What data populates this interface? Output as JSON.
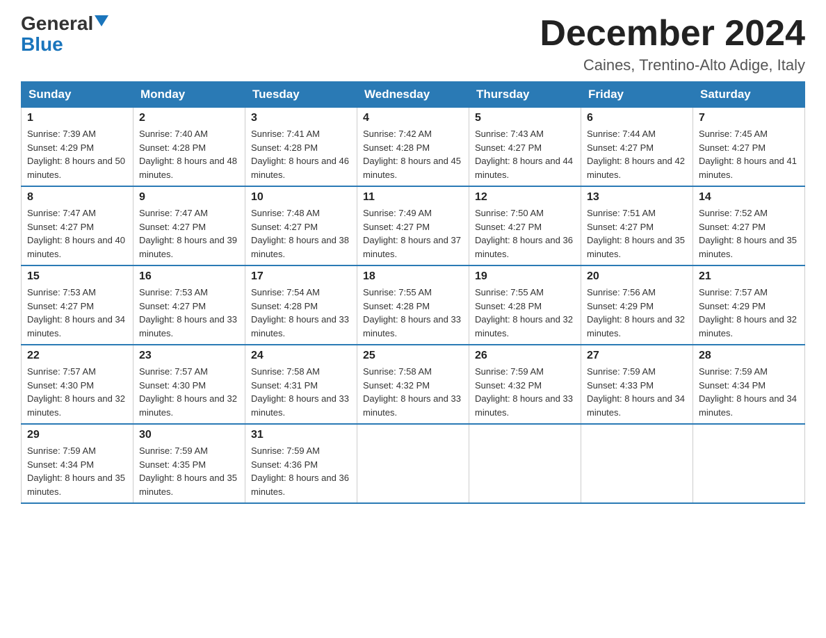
{
  "logo": {
    "general": "General",
    "blue": "Blue"
  },
  "title": "December 2024",
  "location": "Caines, Trentino-Alto Adige, Italy",
  "days_of_week": [
    "Sunday",
    "Monday",
    "Tuesday",
    "Wednesday",
    "Thursday",
    "Friday",
    "Saturday"
  ],
  "weeks": [
    [
      {
        "day": "1",
        "sunrise": "7:39 AM",
        "sunset": "4:29 PM",
        "daylight": "8 hours and 50 minutes."
      },
      {
        "day": "2",
        "sunrise": "7:40 AM",
        "sunset": "4:28 PM",
        "daylight": "8 hours and 48 minutes."
      },
      {
        "day": "3",
        "sunrise": "7:41 AM",
        "sunset": "4:28 PM",
        "daylight": "8 hours and 46 minutes."
      },
      {
        "day": "4",
        "sunrise": "7:42 AM",
        "sunset": "4:28 PM",
        "daylight": "8 hours and 45 minutes."
      },
      {
        "day": "5",
        "sunrise": "7:43 AM",
        "sunset": "4:27 PM",
        "daylight": "8 hours and 44 minutes."
      },
      {
        "day": "6",
        "sunrise": "7:44 AM",
        "sunset": "4:27 PM",
        "daylight": "8 hours and 42 minutes."
      },
      {
        "day": "7",
        "sunrise": "7:45 AM",
        "sunset": "4:27 PM",
        "daylight": "8 hours and 41 minutes."
      }
    ],
    [
      {
        "day": "8",
        "sunrise": "7:47 AM",
        "sunset": "4:27 PM",
        "daylight": "8 hours and 40 minutes."
      },
      {
        "day": "9",
        "sunrise": "7:47 AM",
        "sunset": "4:27 PM",
        "daylight": "8 hours and 39 minutes."
      },
      {
        "day": "10",
        "sunrise": "7:48 AM",
        "sunset": "4:27 PM",
        "daylight": "8 hours and 38 minutes."
      },
      {
        "day": "11",
        "sunrise": "7:49 AM",
        "sunset": "4:27 PM",
        "daylight": "8 hours and 37 minutes."
      },
      {
        "day": "12",
        "sunrise": "7:50 AM",
        "sunset": "4:27 PM",
        "daylight": "8 hours and 36 minutes."
      },
      {
        "day": "13",
        "sunrise": "7:51 AM",
        "sunset": "4:27 PM",
        "daylight": "8 hours and 35 minutes."
      },
      {
        "day": "14",
        "sunrise": "7:52 AM",
        "sunset": "4:27 PM",
        "daylight": "8 hours and 35 minutes."
      }
    ],
    [
      {
        "day": "15",
        "sunrise": "7:53 AM",
        "sunset": "4:27 PM",
        "daylight": "8 hours and 34 minutes."
      },
      {
        "day": "16",
        "sunrise": "7:53 AM",
        "sunset": "4:27 PM",
        "daylight": "8 hours and 33 minutes."
      },
      {
        "day": "17",
        "sunrise": "7:54 AM",
        "sunset": "4:28 PM",
        "daylight": "8 hours and 33 minutes."
      },
      {
        "day": "18",
        "sunrise": "7:55 AM",
        "sunset": "4:28 PM",
        "daylight": "8 hours and 33 minutes."
      },
      {
        "day": "19",
        "sunrise": "7:55 AM",
        "sunset": "4:28 PM",
        "daylight": "8 hours and 32 minutes."
      },
      {
        "day": "20",
        "sunrise": "7:56 AM",
        "sunset": "4:29 PM",
        "daylight": "8 hours and 32 minutes."
      },
      {
        "day": "21",
        "sunrise": "7:57 AM",
        "sunset": "4:29 PM",
        "daylight": "8 hours and 32 minutes."
      }
    ],
    [
      {
        "day": "22",
        "sunrise": "7:57 AM",
        "sunset": "4:30 PM",
        "daylight": "8 hours and 32 minutes."
      },
      {
        "day": "23",
        "sunrise": "7:57 AM",
        "sunset": "4:30 PM",
        "daylight": "8 hours and 32 minutes."
      },
      {
        "day": "24",
        "sunrise": "7:58 AM",
        "sunset": "4:31 PM",
        "daylight": "8 hours and 33 minutes."
      },
      {
        "day": "25",
        "sunrise": "7:58 AM",
        "sunset": "4:32 PM",
        "daylight": "8 hours and 33 minutes."
      },
      {
        "day": "26",
        "sunrise": "7:59 AM",
        "sunset": "4:32 PM",
        "daylight": "8 hours and 33 minutes."
      },
      {
        "day": "27",
        "sunrise": "7:59 AM",
        "sunset": "4:33 PM",
        "daylight": "8 hours and 34 minutes."
      },
      {
        "day": "28",
        "sunrise": "7:59 AM",
        "sunset": "4:34 PM",
        "daylight": "8 hours and 34 minutes."
      }
    ],
    [
      {
        "day": "29",
        "sunrise": "7:59 AM",
        "sunset": "4:34 PM",
        "daylight": "8 hours and 35 minutes."
      },
      {
        "day": "30",
        "sunrise": "7:59 AM",
        "sunset": "4:35 PM",
        "daylight": "8 hours and 35 minutes."
      },
      {
        "day": "31",
        "sunrise": "7:59 AM",
        "sunset": "4:36 PM",
        "daylight": "8 hours and 36 minutes."
      },
      null,
      null,
      null,
      null
    ]
  ]
}
